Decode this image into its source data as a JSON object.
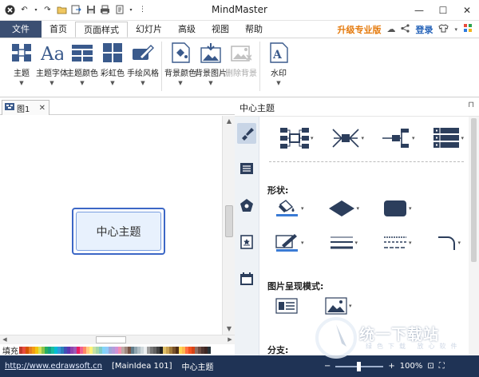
{
  "app": {
    "title": "MindMaster"
  },
  "quick_access": [
    "app-logo-icon",
    "undo-icon",
    "redo-icon",
    "open-icon",
    "save-icon",
    "print-icon",
    "export-icon",
    "more-icon"
  ],
  "menu": {
    "file": "文件",
    "items": [
      "首页",
      "页面样式",
      "幻灯片",
      "高级",
      "视图",
      "帮助"
    ],
    "active": "页面样式",
    "upgrade": "升级专业版",
    "login": "登录"
  },
  "ribbon": {
    "buttons": [
      {
        "label": "主题",
        "icon": "theme-icon"
      },
      {
        "label": "主题字体",
        "icon": "font-icon"
      },
      {
        "label": "主题颜色",
        "icon": "theme-color-icon"
      },
      {
        "label": "彩虹色",
        "icon": "rainbow-icon"
      },
      {
        "label": "手绘风格",
        "icon": "handdrawn-icon"
      }
    ],
    "buttons2": [
      {
        "label": "背景颜色",
        "icon": "bg-color-icon"
      },
      {
        "label": "背景图片",
        "icon": "bg-image-icon"
      },
      {
        "label": "删除背景",
        "icon": "delete-bg-icon",
        "disabled": true
      }
    ],
    "buttons3": [
      {
        "label": "水印",
        "icon": "watermark-icon"
      }
    ]
  },
  "doc_tab": {
    "label": "图1"
  },
  "canvas": {
    "central_topic": "中心主题"
  },
  "panel": {
    "title": "中心主题",
    "shape_label": "形状:",
    "image_mode_label": "图片呈现模式:",
    "branch_label": "分支:"
  },
  "palette": {
    "label": "填充"
  },
  "status": {
    "url": "http://www.edrawsoft.cn",
    "file": "[MainIdea 101]",
    "topic": "中心主题",
    "zoom": "100%"
  },
  "watermark": {
    "text": "统一下载站",
    "sub": "绿色下载 放心软件"
  },
  "colors": {
    "status_bar": "#1f3355",
    "file_menu": "#3b4f72",
    "accent": "#3c67c6",
    "upgrade": "#e57b0e"
  }
}
